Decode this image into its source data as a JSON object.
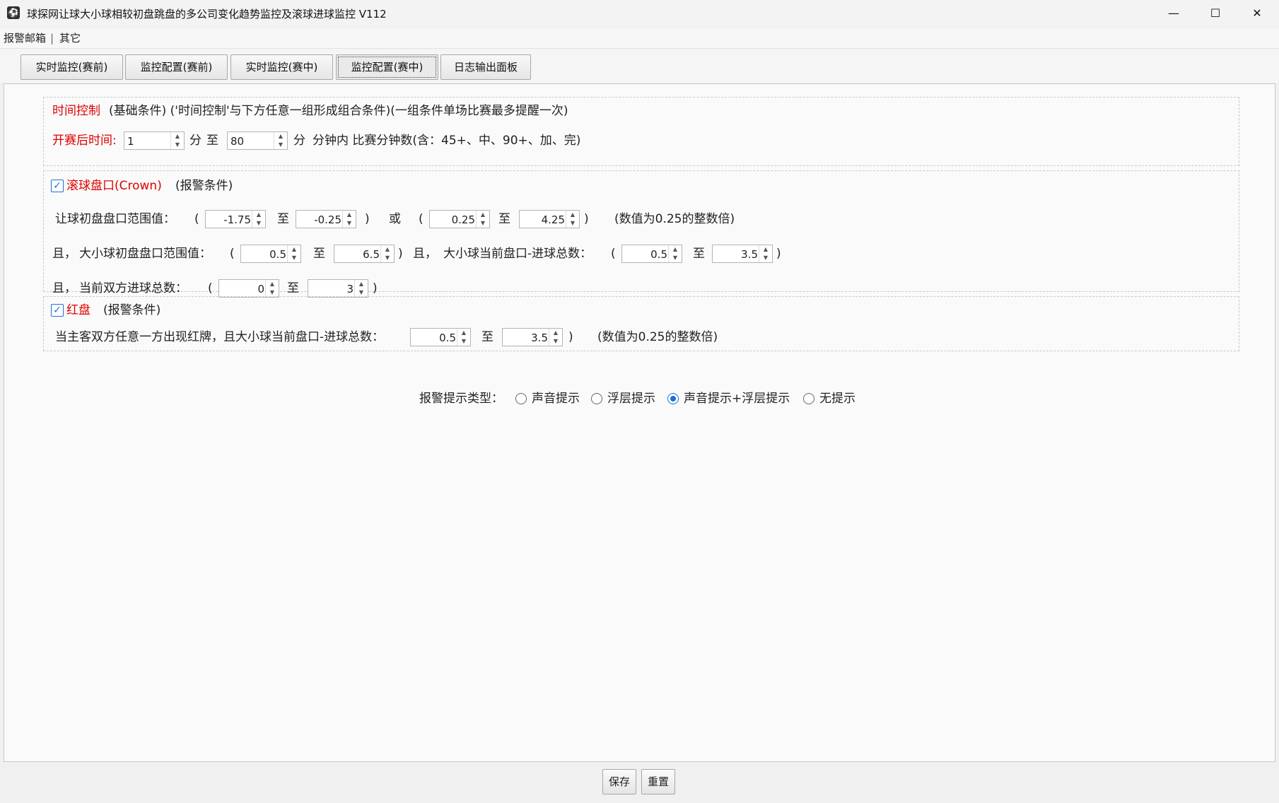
{
  "window": {
    "title": "球探网让球大小球相较初盘跳盘的多公司变化趋势监控及滚球进球监控 V112",
    "minimize_icon": "—",
    "maximize_icon": "☐",
    "close_icon": "✕"
  },
  "menu": {
    "items": [
      "报警邮箱",
      "|",
      "其它"
    ]
  },
  "tabs": [
    "实时监控(赛前)",
    "监控配置(赛前)",
    "实时监控(赛中)",
    "监控配置(赛中)",
    "日志输出面板"
  ],
  "time_control": {
    "title": "时间控制",
    "desc": "(基础条件) ('时间控制'与下方任意一组形成组合条件)(一组条件单场比赛最多提醒一次)",
    "label": "开赛后时间:",
    "from": "1",
    "unit1": "分",
    "to_word": "至",
    "to": "80",
    "unit2": "分",
    "suffix": "分钟内 比赛分钟数(含：45+、中、90+、加、完)"
  },
  "crown": {
    "checked": "✓",
    "title": "滚球盘口(Crown)",
    "subtitle": "(报警条件)",
    "row1": {
      "label": "让球初盘盘口范围值：",
      "open1": "(",
      "v1": "-1.75",
      "to1": "至",
      "v2": "-0.25",
      "close1": ")",
      "or": "或",
      "open2": "(",
      "v3": "0.25",
      "to2": "至",
      "v4": "4.25",
      "close2": ")",
      "note": "(数值为0.25的整数倍)"
    },
    "row2": {
      "and1": "且，",
      "label1": "大小球初盘盘口范围值：",
      "open1": "(",
      "v1": "0.5",
      "to1": "至",
      "v2": "6.5",
      "close1": ")",
      "and2": "且，",
      "label2": "大小球当前盘口-进球总数：",
      "open2": "(",
      "v3": "0.5",
      "to2": "至",
      "v4": "3.5",
      "close2": ")"
    },
    "row3": {
      "and1": "且，",
      "label": "当前双方进球总数：",
      "open": "(",
      "v1": "0",
      "to": "至",
      "v2": "3",
      "close": ")"
    }
  },
  "redcard": {
    "checked": "✓",
    "title": "红盘",
    "subtitle": "(报警条件)",
    "label": "当主客双方任意一方出现红牌，且大小球当前盘口-进球总数：",
    "v1": "0.5",
    "to": "至",
    "v2": "3.5",
    "close": ")",
    "note": "(数值为0.25的整数倍)"
  },
  "alert_type": {
    "label": "报警提示类型：",
    "options": [
      "声音提示",
      "浮层提示",
      "声音提示+浮层提示",
      "无提示"
    ],
    "selected_index": 2
  },
  "footer": {
    "save": "保存",
    "reset": "重置"
  },
  "spin_arrows": "▲\n▼"
}
